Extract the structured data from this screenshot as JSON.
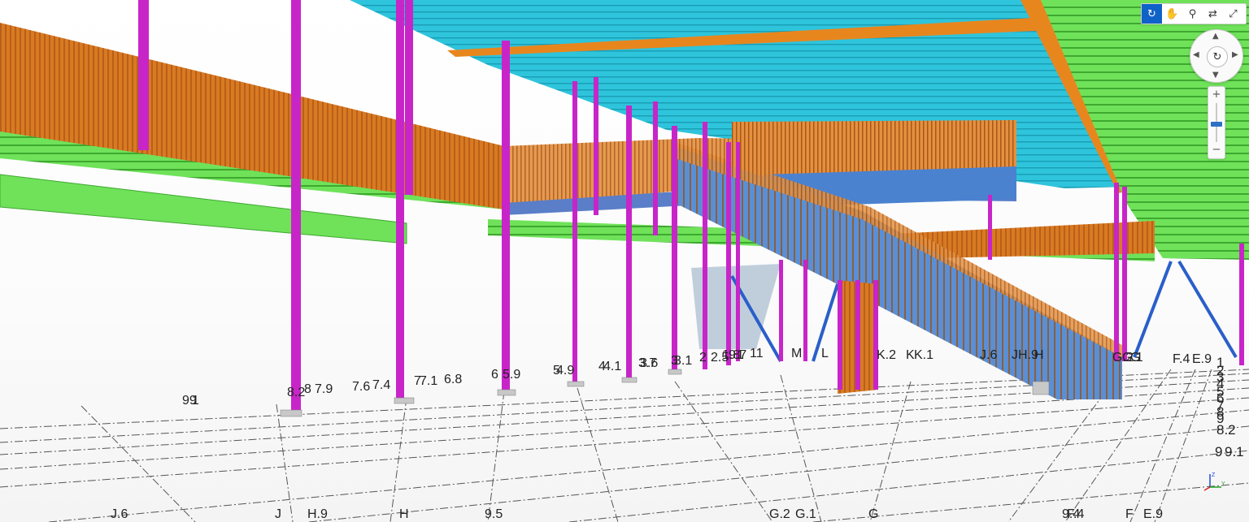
{
  "colors": {
    "roof_deck": "#2ec4dc",
    "walkway": "#6fe25a",
    "railing": "#e0862a",
    "column": "#c825c8",
    "stair": "#4a82d0",
    "bracing": "#2a5fc9",
    "grid_line": "#555555",
    "accent": "#0f62c7"
  },
  "toolbar": {
    "tools": [
      {
        "name": "orbit",
        "icon": "orbit-icon",
        "glyph": "↻",
        "active": true
      },
      {
        "name": "pan",
        "icon": "pan-hand-icon",
        "glyph": "✋",
        "active": false
      },
      {
        "name": "walk",
        "icon": "walk-icon",
        "glyph": "⚲",
        "active": false
      },
      {
        "name": "switch",
        "icon": "swap-icon",
        "glyph": "⇄",
        "active": false
      },
      {
        "name": "fit",
        "icon": "expand-icon",
        "glyph": "⤢",
        "active": false
      }
    ]
  },
  "navwheel": {
    "up": "▲",
    "down": "▼",
    "left": "◀",
    "right": "▶",
    "center": "↻"
  },
  "zoom": {
    "plus": "+",
    "minus": "−",
    "level": 0.45
  },
  "triad": {
    "x": "Y",
    "z": "Z"
  },
  "grid_labels_far": [
    "99",
    "1",
    "8.2",
    "8",
    "7.9",
    "7.6",
    "7.4",
    "7",
    "7.1",
    "6.8",
    "6",
    "5.9",
    "5",
    "4.9",
    "4",
    "4.1",
    "3.7",
    "3.6",
    "3",
    "3.1",
    "2.5",
    "2",
    "1.8",
    "1",
    "9.7",
    "11",
    "M",
    "L",
    "K.2",
    "K",
    "K.1",
    "J.6",
    "J",
    "H.9",
    "H",
    "G.2",
    "G.1",
    "G",
    "F.4",
    "E.9"
  ],
  "grid_labels_near": [
    "J.6",
    "J",
    "H.9",
    "H",
    "9.5",
    "G.2",
    "G.1",
    "G",
    "9.4",
    "F.4",
    "F",
    "E.9"
  ],
  "grid_labels_right": [
    "1",
    "2",
    "3",
    "4",
    "5",
    "6",
    "7",
    "8",
    "9",
    "8.2",
    "9",
    "9.1"
  ]
}
